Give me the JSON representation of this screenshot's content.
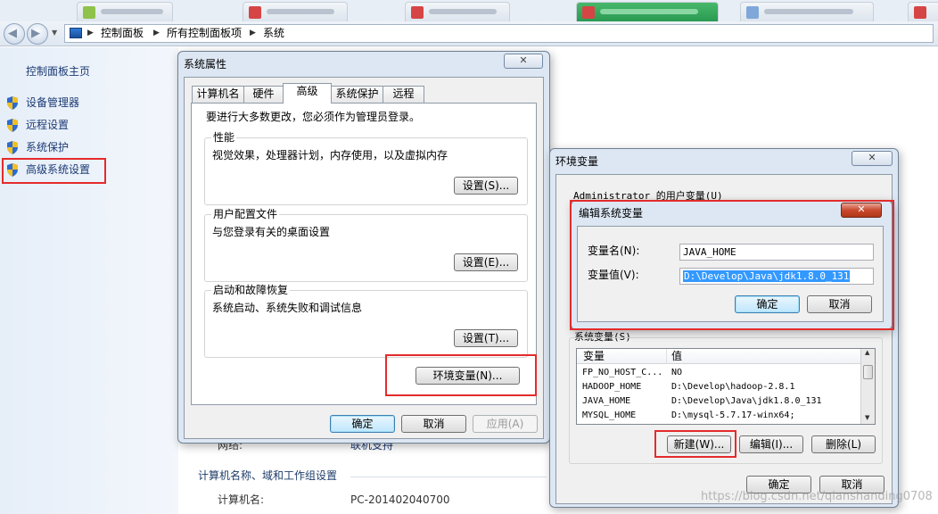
{
  "breadcrumb": {
    "items": [
      "控制面板",
      "所有控制面板项",
      "系统"
    ]
  },
  "left_pane": {
    "home_label": "控制面板主页",
    "links": [
      {
        "label": "设备管理器"
      },
      {
        "label": "远程设置"
      },
      {
        "label": "系统保护"
      },
      {
        "label": "高级系统设置"
      }
    ]
  },
  "main_content": {
    "network_label": "网络:",
    "network_link": "联机支持",
    "section_title": "计算机名称、域和工作组设置",
    "computer_name_label": "计算机名:",
    "computer_name_value": "PC-201402040700"
  },
  "sys_props": {
    "title": "系统属性",
    "close_label": "✕",
    "tabs": [
      "计算机名",
      "硬件",
      "高级",
      "系统保护",
      "远程"
    ],
    "active_tab": "高级",
    "admin_note": "要进行大多数更改，您必须作为管理员登录。",
    "performance": {
      "title": "性能",
      "desc": "视觉效果，处理器计划，内存使用，以及虚拟内存",
      "button": "设置(S)..."
    },
    "user_profiles": {
      "title": "用户配置文件",
      "desc": "与您登录有关的桌面设置",
      "button": "设置(E)..."
    },
    "startup": {
      "title": "启动和故障恢复",
      "desc": "系统启动、系统失败和调试信息",
      "button": "设置(T)..."
    },
    "env_button": "环境变量(N)...",
    "ok": "确定",
    "cancel": "取消",
    "apply": "应用(A)"
  },
  "env_vars": {
    "title": "环境变量",
    "close_label": "✕",
    "user_vars_label": "Administrator 的用户变量(U)",
    "system_vars_label": "系统变量(S)",
    "columns": [
      "变量",
      "值"
    ],
    "rows": [
      {
        "name": "FP_NO_HOST_C...",
        "value": "NO"
      },
      {
        "name": "HADOOP_HOME",
        "value": "D:\\Develop\\hadoop-2.8.1"
      },
      {
        "name": "JAVA_HOME",
        "value": "D:\\Develop\\Java\\jdk1.8.0_131"
      },
      {
        "name": "MYSQL_HOME",
        "value": "D:\\mysql-5.7.17-winx64;"
      }
    ],
    "new_button": "新建(W)...",
    "edit_button": "编辑(I)...",
    "delete_button": "删除(L)",
    "ok": "确定",
    "cancel": "取消"
  },
  "edit_var": {
    "title": "编辑系统变量",
    "close_label": "✕",
    "name_label": "变量名(N):",
    "value_label": "变量值(V):",
    "name_value": "JAVA_HOME",
    "value_value": "D:\\Develop\\Java\\jdk1.8.0_131",
    "ok": "确定",
    "cancel": "取消"
  },
  "watermark": "https://blog.csdn.net/qianshanding0708",
  "colors": {
    "highlight_box": "#e42b2b",
    "selection": "#3399ff",
    "link": "#1b3a74"
  }
}
